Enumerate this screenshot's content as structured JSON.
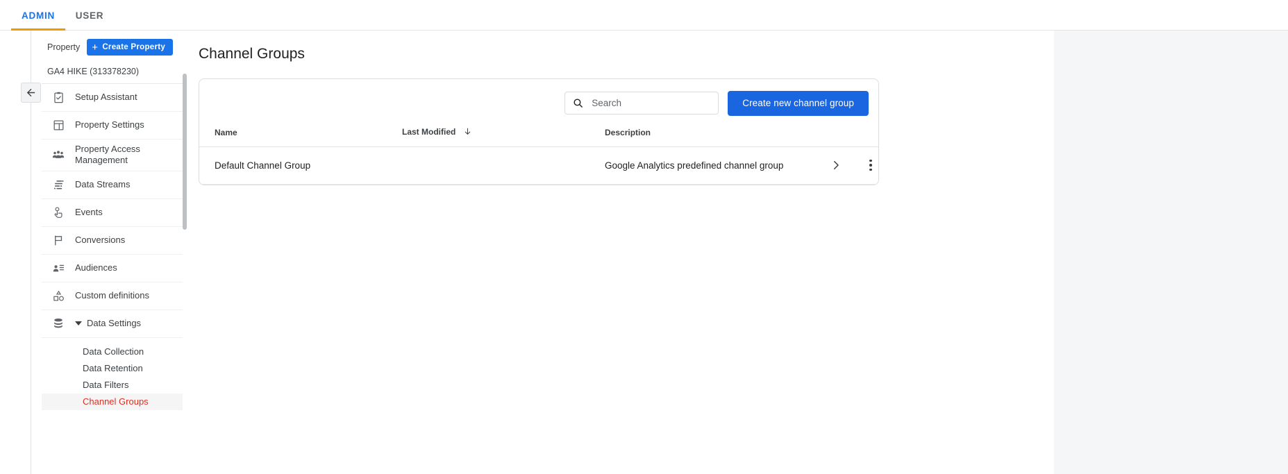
{
  "tabs": [
    {
      "id": "admin",
      "label": "ADMIN",
      "active": true
    },
    {
      "id": "user",
      "label": "USER",
      "active": false
    }
  ],
  "sidebar": {
    "property_label": "Property",
    "create_property_button": "Create Property",
    "create_property_icon": "plus-icon",
    "property_name": "GA4 HIKE (313378230)",
    "collapse_icon": "arrow-left-icon",
    "items": [
      {
        "label": "Setup Assistant",
        "icon": "clipboard-check-icon"
      },
      {
        "label": "Property Settings",
        "icon": "property-panel-icon"
      },
      {
        "label": "Property Access Management",
        "icon": "people-group-icon"
      },
      {
        "label": "Data Streams",
        "icon": "data-streams-icon"
      },
      {
        "label": "Events",
        "icon": "tap-hand-icon"
      },
      {
        "label": "Conversions",
        "icon": "flag-icon"
      },
      {
        "label": "Audiences",
        "icon": "person-list-icon"
      },
      {
        "label": "Custom definitions",
        "icon": "shapes-icon"
      },
      {
        "label": "Data Settings",
        "icon": "database-icon",
        "expandable": true,
        "expanded": true
      }
    ],
    "sub_items": [
      {
        "label": "Data Collection",
        "selected": false
      },
      {
        "label": "Data Retention",
        "selected": false
      },
      {
        "label": "Data Filters",
        "selected": false
      },
      {
        "label": "Channel Groups",
        "selected": true
      }
    ]
  },
  "main": {
    "page_title": "Channel Groups",
    "search": {
      "placeholder": "Search",
      "value": "",
      "icon": "search-icon"
    },
    "create_button": "Create new channel group",
    "table": {
      "columns": [
        {
          "key": "name",
          "label": "Name"
        },
        {
          "key": "last_modified",
          "label": "Last Modified",
          "sort": "desc",
          "sort_icon": "arrow-down-icon"
        },
        {
          "key": "description",
          "label": "Description"
        }
      ],
      "rows": [
        {
          "name": "Default Channel Group",
          "last_modified": "",
          "description": "Google Analytics predefined channel group",
          "chevron_icon": "chevron-right-icon",
          "menu_icon": "more-vert-icon"
        }
      ]
    }
  },
  "colors": {
    "accent_blue": "#1a73e8",
    "button_blue": "#1a66e0",
    "tab_underline_orange": "#f29900",
    "selected_red": "#d93025",
    "page_background": "#f4f6f8"
  }
}
